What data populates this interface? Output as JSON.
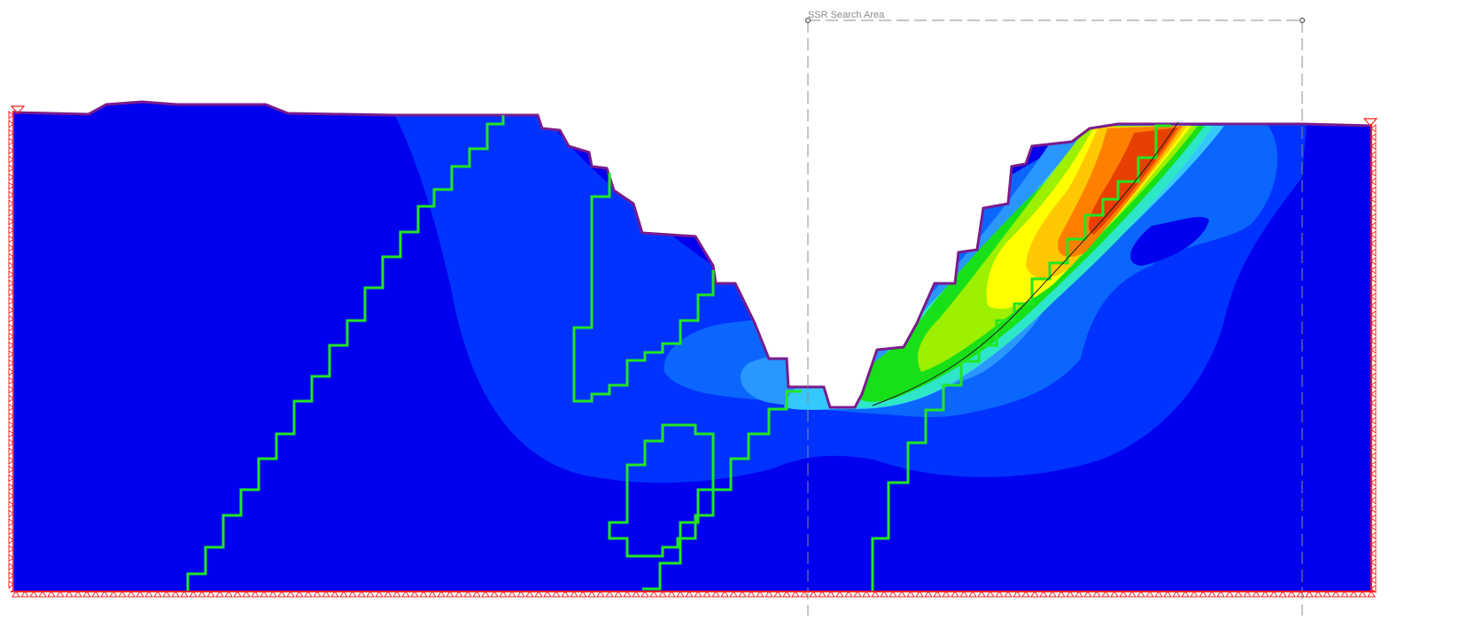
{
  "view": {
    "type": "slope stability finite element model",
    "search_area": {
      "label": "SSR Search Area",
      "line_style": "dashed",
      "line_color": "#8c8c8c"
    }
  },
  "colors": {
    "background": "#ffffff",
    "ground_surface": "#7a1b8c",
    "material_boundary": "#22e622",
    "failure_surface": "#1a1a1a",
    "supports": "#ff2020",
    "contour_scale": [
      "#0000ee",
      "#0033ff",
      "#0a66ff",
      "#2a96ff",
      "#35c8ff",
      "#2ee6c8",
      "#18e018",
      "#9cf000",
      "#ffff00",
      "#ffc800",
      "#ff8000",
      "#e84000"
    ]
  },
  "icons": {
    "supports_left": "pin-roller-icon",
    "supports_right": "pin-roller-icon",
    "supports_bottom": "fixed-pin-icon",
    "water_table_left": "water-level-triangle-icon",
    "water_table_right": "water-level-triangle-icon"
  }
}
